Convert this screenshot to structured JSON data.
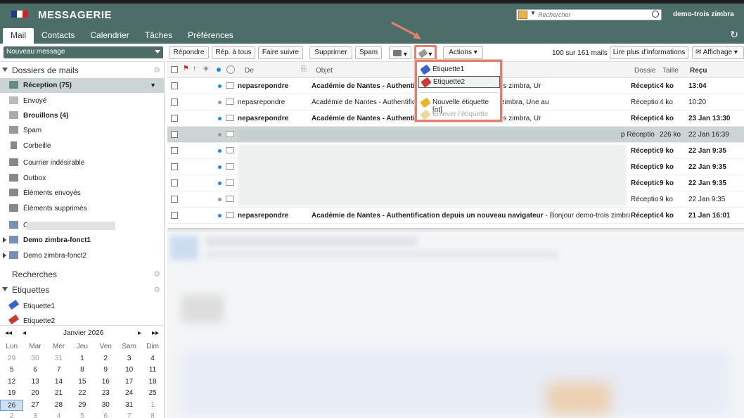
{
  "app": {
    "brand": "MESSAGERIE",
    "user": "demo-trois zimbra",
    "search_placeholder": "Rechercher"
  },
  "tabs": [
    "Mail",
    "Contacts",
    "Calendrier",
    "Tâches",
    "Préférences"
  ],
  "toolbar": {
    "new_message": "Nouveau message",
    "reply": "Répondre",
    "reply_all": "Rép. à tous",
    "forward": "Faire suivre",
    "delete": "Supprimer",
    "spam": "Spam",
    "actions": "Actions",
    "count": "100 sur 161 mails",
    "read_more": "Lire plus d'informations",
    "display": "Affichage"
  },
  "sidebar": {
    "mail_folders": "Dossiers de mails",
    "folders": [
      {
        "label": "Réception (75)"
      },
      {
        "label": "Envoyé"
      },
      {
        "label": "Brouillons (4)"
      },
      {
        "label": "Spam"
      },
      {
        "label": "Corbeille"
      },
      {
        "label": "Courrier indésirable"
      },
      {
        "label": "Outbox"
      },
      {
        "label": "Éléments envoyés"
      },
      {
        "label": "Éléments supprimés"
      },
      {
        "label": "C"
      },
      {
        "label": "Demo zimbra-fonct1"
      },
      {
        "label": "Demo zimbra-fonct2"
      }
    ],
    "searches": "Recherches",
    "tags_title": "Etiquettes",
    "tags": [
      "Etiquette1",
      "Etiquette2"
    ]
  },
  "calendar": {
    "month": "Janvier 2026",
    "days": [
      "Lun",
      "Mar",
      "Mer",
      "Jeu",
      "Ven",
      "Sam",
      "Dim"
    ],
    "weeks": [
      [
        "29",
        "30",
        "31",
        "1",
        "2",
        "3",
        "4"
      ],
      [
        "5",
        "6",
        "7",
        "8",
        "9",
        "10",
        "11"
      ],
      [
        "12",
        "13",
        "14",
        "15",
        "16",
        "17",
        "18"
      ],
      [
        "19",
        "20",
        "21",
        "22",
        "23",
        "24",
        "25"
      ],
      [
        "26",
        "27",
        "28",
        "29",
        "30",
        "31",
        "1"
      ],
      [
        "2",
        "3",
        "4",
        "5",
        "6",
        "7",
        "8"
      ]
    ],
    "today": "26"
  },
  "list": {
    "headers": {
      "from": "De",
      "subject": "Objet",
      "folder": "Dossie",
      "size": "Taille",
      "received": "Reçu"
    },
    "rows": [
      {
        "from": "nepasrepondre",
        "subj_b": "Académie de Nantes - Authentific",
        "subj_r": "ateur - Bonjour demo-trois zimbra, Ur",
        "folder": "Réception",
        "size": "4 ko",
        "date": "13:04",
        "unread": true
      },
      {
        "from": "nepasrepondre",
        "subj_b": "Académie de Nantes - Authentific",
        "subj_r": "ateur - Bonjour demo-trois zimbra, Une au",
        "folder": "Réception",
        "size": "4 ko",
        "date": "10:20",
        "unread": false
      },
      {
        "from": "nepasrepondre",
        "subj_b": "Académie de Nantes - Authentific",
        "subj_r": "ateur - Bonjour demo-trois zimbra, Ur",
        "folder": "Réception",
        "size": "4 ko",
        "date": "23 Jan 13:30",
        "unread": true
      },
      {
        "from": "",
        "subj_b": "",
        "subj_r": "",
        "folder": "p Réceptio",
        "size": "226 ko",
        "date": "22 Jan 16:39",
        "unread": false
      },
      {
        "from": "",
        "subj_b": "",
        "subj_r": "",
        "folder": "Réceptio",
        "size": "9 ko",
        "date": "22 Jan 9:35",
        "unread": true
      },
      {
        "from": "",
        "subj_b": "",
        "subj_r": "",
        "folder": "Réceptio",
        "size": "9 ko",
        "date": "22 Jan 9:35",
        "unread": true
      },
      {
        "from": "",
        "subj_b": "",
        "subj_r": "",
        "folder": "Réceptio",
        "size": "9 ko",
        "date": "22 Jan 9:35",
        "unread": true
      },
      {
        "from": "",
        "subj_b": "",
        "subj_r": "",
        "folder": "Réceptio",
        "size": "9 ko",
        "date": "22 Jan 9:35",
        "unread": false
      },
      {
        "from": "nepasrepondre",
        "subj_b": "Académie de Nantes - Authentification depuis un nouveau navigateur",
        "subj_r": " - Bonjour demo-trois zimbra, Ur",
        "folder": "Réception",
        "size": "4 ko",
        "date": "21 Jan 16:01",
        "unread": true
      }
    ]
  },
  "tag_menu": {
    "items": [
      "Etiquette1",
      "Etiquette2",
      "Nouvelle étiquette [nt]",
      "Enlever l'étiquette"
    ]
  },
  "colors": {
    "header": "#4d6e68",
    "tag1": "#3b64c8",
    "tag2": "#c83b3b",
    "highlight": "#e08070"
  }
}
